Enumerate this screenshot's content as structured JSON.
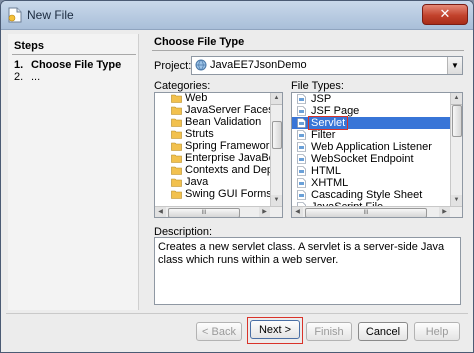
{
  "window": {
    "title": "New File",
    "close_label": "✕"
  },
  "steps": {
    "title": "Steps",
    "items": [
      {
        "num": "1.",
        "label": "Choose File Type"
      },
      {
        "num": "2.",
        "label": "..."
      }
    ]
  },
  "main": {
    "title": "Choose File Type",
    "project_label": "Project:",
    "project_value": "JavaEE7JsonDemo",
    "categories_label": "Categories:",
    "file_types_label": "File Types:",
    "categories": [
      {
        "label": "Web",
        "icon": "folder-icon"
      },
      {
        "label": "JavaServer Faces",
        "icon": "folder-icon"
      },
      {
        "label": "Bean Validation",
        "icon": "folder-icon"
      },
      {
        "label": "Struts",
        "icon": "folder-icon"
      },
      {
        "label": "Spring Framework",
        "icon": "folder-icon"
      },
      {
        "label": "Enterprise JavaBean",
        "icon": "folder-icon"
      },
      {
        "label": "Contexts and Depen",
        "icon": "folder-icon"
      },
      {
        "label": "Java",
        "icon": "folder-icon"
      },
      {
        "label": "Swing GUI Forms",
        "icon": "folder-icon"
      }
    ],
    "file_types": [
      {
        "label": "JSP",
        "icon": "jsp-file-icon"
      },
      {
        "label": "JSF Page",
        "icon": "jsf-file-icon"
      },
      {
        "label": "Servlet",
        "icon": "servlet-file-icon"
      },
      {
        "label": "Filter",
        "icon": "filter-file-icon"
      },
      {
        "label": "Web Application Listener",
        "icon": "listener-file-icon"
      },
      {
        "label": "WebSocket Endpoint",
        "icon": "websocket-file-icon"
      },
      {
        "label": "HTML",
        "icon": "html-file-icon"
      },
      {
        "label": "XHTML",
        "icon": "xhtml-file-icon"
      },
      {
        "label": "Cascading Style Sheet",
        "icon": "css-file-icon"
      },
      {
        "label": "JavaScript File",
        "icon": "js-file-icon"
      }
    ],
    "selected_file_type": "Servlet",
    "description_label": "Description:",
    "description": "Creates a new servlet class. A servlet is a server-side Java class which runs within a web server."
  },
  "buttons": {
    "back": "< Back",
    "next": "Next >",
    "finish": "Finish",
    "cancel": "Cancel",
    "help": "Help"
  },
  "colors": {
    "selection": "#3875d7",
    "highlight_box": "#d9332a",
    "titlebar": "#b8cbe2"
  }
}
